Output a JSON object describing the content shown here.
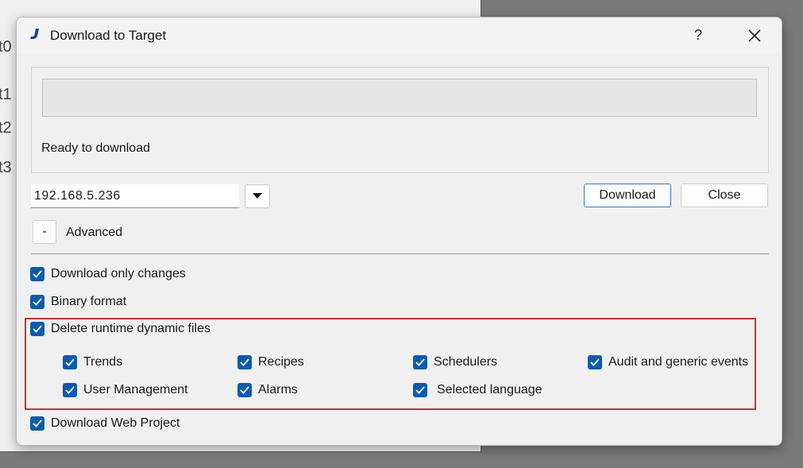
{
  "background": {
    "labels": [
      "t0",
      "t1",
      "t2",
      "t3"
    ]
  },
  "dialog": {
    "title": "Download to Target",
    "help_label": "?",
    "progress": 0,
    "status": "Ready to download",
    "ip_address": "192.168.5.236",
    "download_label": "Download",
    "close_label": "Close",
    "advanced_toggle": "-",
    "advanced_label": "Advanced"
  },
  "options": {
    "download_only_changes": {
      "label": "Download only changes",
      "checked": true
    },
    "binary_format": {
      "label": "Binary format",
      "checked": true
    },
    "delete_runtime_dynamic_files": {
      "label": "Delete runtime dynamic files",
      "checked": true
    },
    "download_web_project": {
      "label": "Download Web Project",
      "checked": true
    }
  },
  "dynamic_files": [
    {
      "label": "Trends",
      "checked": true
    },
    {
      "label": "Recipes",
      "checked": true
    },
    {
      "label": "Schedulers",
      "checked": true
    },
    {
      "label": "Audit and generic events",
      "checked": true
    },
    {
      "label": "User Management",
      "checked": true
    },
    {
      "label": "Alarms",
      "checked": true
    },
    {
      "label": "Selected language",
      "checked": true
    }
  ],
  "colors": {
    "accent": "#0b5cad",
    "highlight_border": "#d32f2f"
  }
}
